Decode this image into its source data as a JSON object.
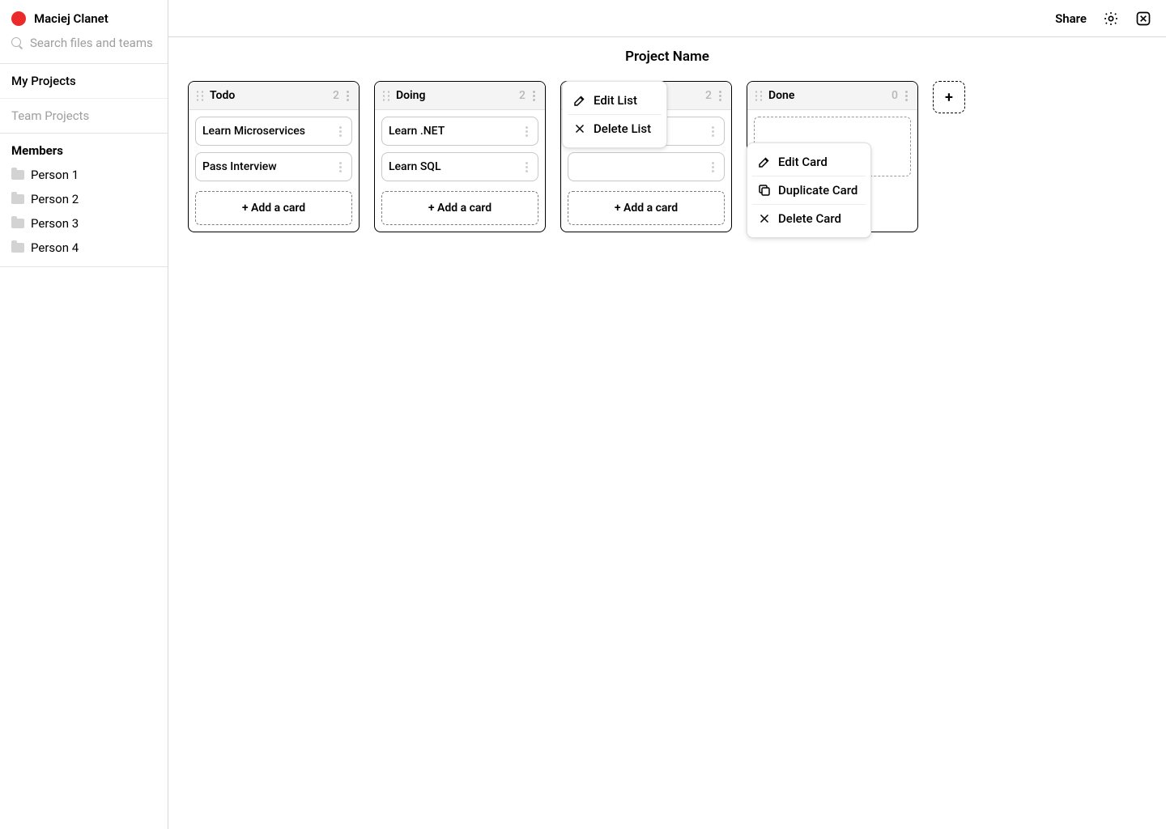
{
  "user": {
    "name": "Maciej Clanet"
  },
  "search": {
    "placeholder": "Search files and teams"
  },
  "sidebar": {
    "myProjects": "My Projects",
    "teamProjects": "Team Projects",
    "membersHeader": "Members",
    "members": [
      "Person 1",
      "Person 2",
      "Person 3",
      "Person 4"
    ]
  },
  "topbar": {
    "share": "Share"
  },
  "project": {
    "name": "Project Name"
  },
  "addCardLabel": "+ Add a card",
  "addListLabel": "+",
  "lists": [
    {
      "title": "Todo",
      "count": 2,
      "cards": [
        "Learn Microservices",
        "Pass Interview"
      ]
    },
    {
      "title": "Doing",
      "count": 2,
      "cards": [
        "Learn .NET",
        "Learn SQL"
      ]
    },
    {
      "title": "",
      "count": 2,
      "cards": [
        "",
        ""
      ]
    },
    {
      "title": "Done",
      "count": 0,
      "cards": []
    }
  ],
  "listMenu": {
    "edit": "Edit List",
    "delete": "Delete List"
  },
  "cardMenu": {
    "edit": "Edit Card",
    "duplicate": "Duplicate Card",
    "delete": "Delete Card"
  }
}
